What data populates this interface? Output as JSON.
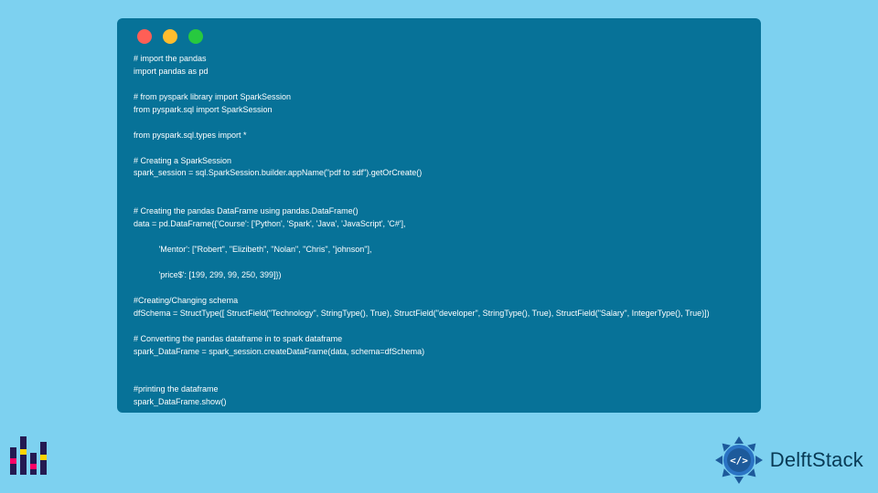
{
  "code": {
    "lines": [
      "# import the pandas",
      "import pandas as pd",
      "",
      "# from pyspark library import SparkSession",
      "from pyspark.sql import SparkSession",
      "",
      "from pyspark.sql.types import *",
      "",
      "# Creating a SparkSession",
      "spark_session = sql.SparkSession.builder.appName(\"pdf to sdf\").getOrCreate()",
      "",
      "",
      "# Creating the pandas DataFrame using pandas.DataFrame()",
      "data = pd.DataFrame({'Course': ['Python', 'Spark', 'Java', 'JavaScript', 'C#'],",
      "",
      "           'Mentor': [\"Robert\", \"Elizibeth\", \"Nolan\", \"Chris\", \"johnson\"],",
      "",
      "           'price$': [199, 299, 99, 250, 399]})",
      "",
      "#Creating/Changing schema",
      "dfSchema = StructType([ StructField(\"Technology\", StringType(), True), StructField(\"developer\", StringType(), True), StructField(\"Salary\", IntegerType(), True)])",
      "",
      "# Converting the pandas dataframe in to spark dataframe",
      "spark_DataFrame = spark_session.createDataFrame(data, schema=dfSchema)",
      "",
      "",
      "#printing the dataframe",
      "spark_DataFrame.show()"
    ]
  },
  "brand": {
    "name": "DelftStack"
  }
}
